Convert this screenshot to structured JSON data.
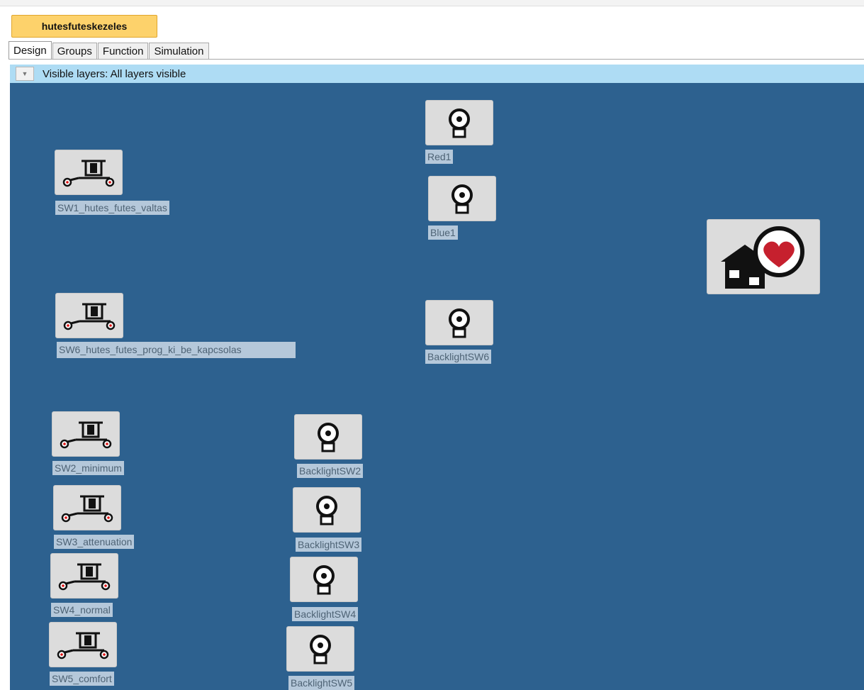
{
  "document_tab": "hutesfuteskezeles",
  "tabs": [
    "Design",
    "Groups",
    "Function",
    "Simulation"
  ],
  "layer_bar": {
    "label": "Visible layers:",
    "value": "All layers visible"
  },
  "devices": {
    "sw1": "SW1_hutes_futes_valtas",
    "sw6": "SW6_hutes_futes_prog_ki_be_kapcsolas",
    "sw2": "SW2_minimum",
    "sw3": "SW3_attenuation",
    "sw4": "SW4_normal",
    "sw5": "SW5_comfort",
    "red1": "Red1",
    "blue1": "Blue1",
    "bl6": "BacklightSW6",
    "bl2": "BacklightSW2",
    "bl3": "BacklightSW3",
    "bl4": "BacklightSW4",
    "bl5": "BacklightSW5"
  },
  "icons": {
    "switch": "switch-actuator-icon",
    "light": "light-bulb-icon",
    "home": "smart-home-heart-icon"
  },
  "colors": {
    "canvas": "#2d618f",
    "tab_highlight": "#fdd26b",
    "layer_bar": "#aedcf4",
    "heart": "#c6202e"
  }
}
